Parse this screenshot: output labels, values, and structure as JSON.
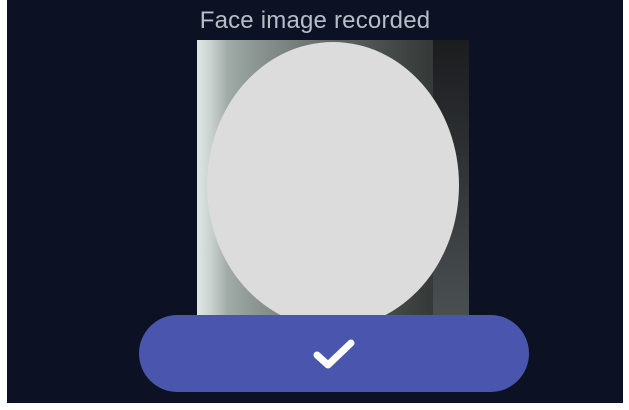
{
  "header": {
    "title": "Face image recorded"
  },
  "photo": {
    "face_obscured": true
  },
  "confirm": {
    "icon": "check-icon"
  },
  "colors": {
    "background": "#0c1124",
    "title_text": "#b9bdc8",
    "button": "#4a56ad",
    "face_mask": "#dcdcdc"
  }
}
